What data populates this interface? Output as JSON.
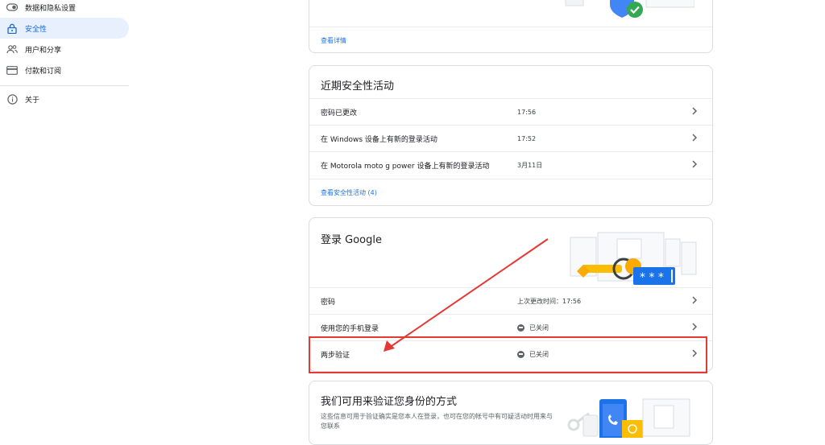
{
  "sidebar": {
    "items": [
      {
        "label": "数据和隐私设置",
        "icon": "toggle-icon"
      },
      {
        "label": "安全性",
        "icon": "lock-icon",
        "active": true
      },
      {
        "label": "用户和分享",
        "icon": "people-icon"
      },
      {
        "label": "付款和订阅",
        "icon": "credit-card-icon"
      },
      {
        "label": "关于",
        "icon": "info-icon"
      }
    ]
  },
  "top_card": {
    "link": "查看详情"
  },
  "recent_activity": {
    "title": "近期安全性活动",
    "rows": [
      {
        "label": "密码已更改",
        "time": "17:56"
      },
      {
        "label": "在 Windows 设备上有新的登录活动",
        "time": "17:52"
      },
      {
        "label": "在 Motorola moto g power 设备上有新的登录活动",
        "time": "3月11日"
      }
    ],
    "link": "查看安全性活动 (4)"
  },
  "signin": {
    "title": "登录 Google",
    "rows": [
      {
        "label": "密码",
        "value": "上次更改时间：17:56"
      },
      {
        "label": "使用您的手机登录",
        "value": "已关闭"
      },
      {
        "label": "两步验证",
        "value": "已关闭"
      }
    ]
  },
  "verify": {
    "title": "我们可用来验证您身份的方式",
    "desc": "这些信息可用于验证确实是您本人在登录，也可在您的帐号中有可疑活动时用来与您联系"
  },
  "colors": {
    "accent": "#1a73e8",
    "highlight": "#e53935",
    "active_bg": "#e8f0fe"
  }
}
